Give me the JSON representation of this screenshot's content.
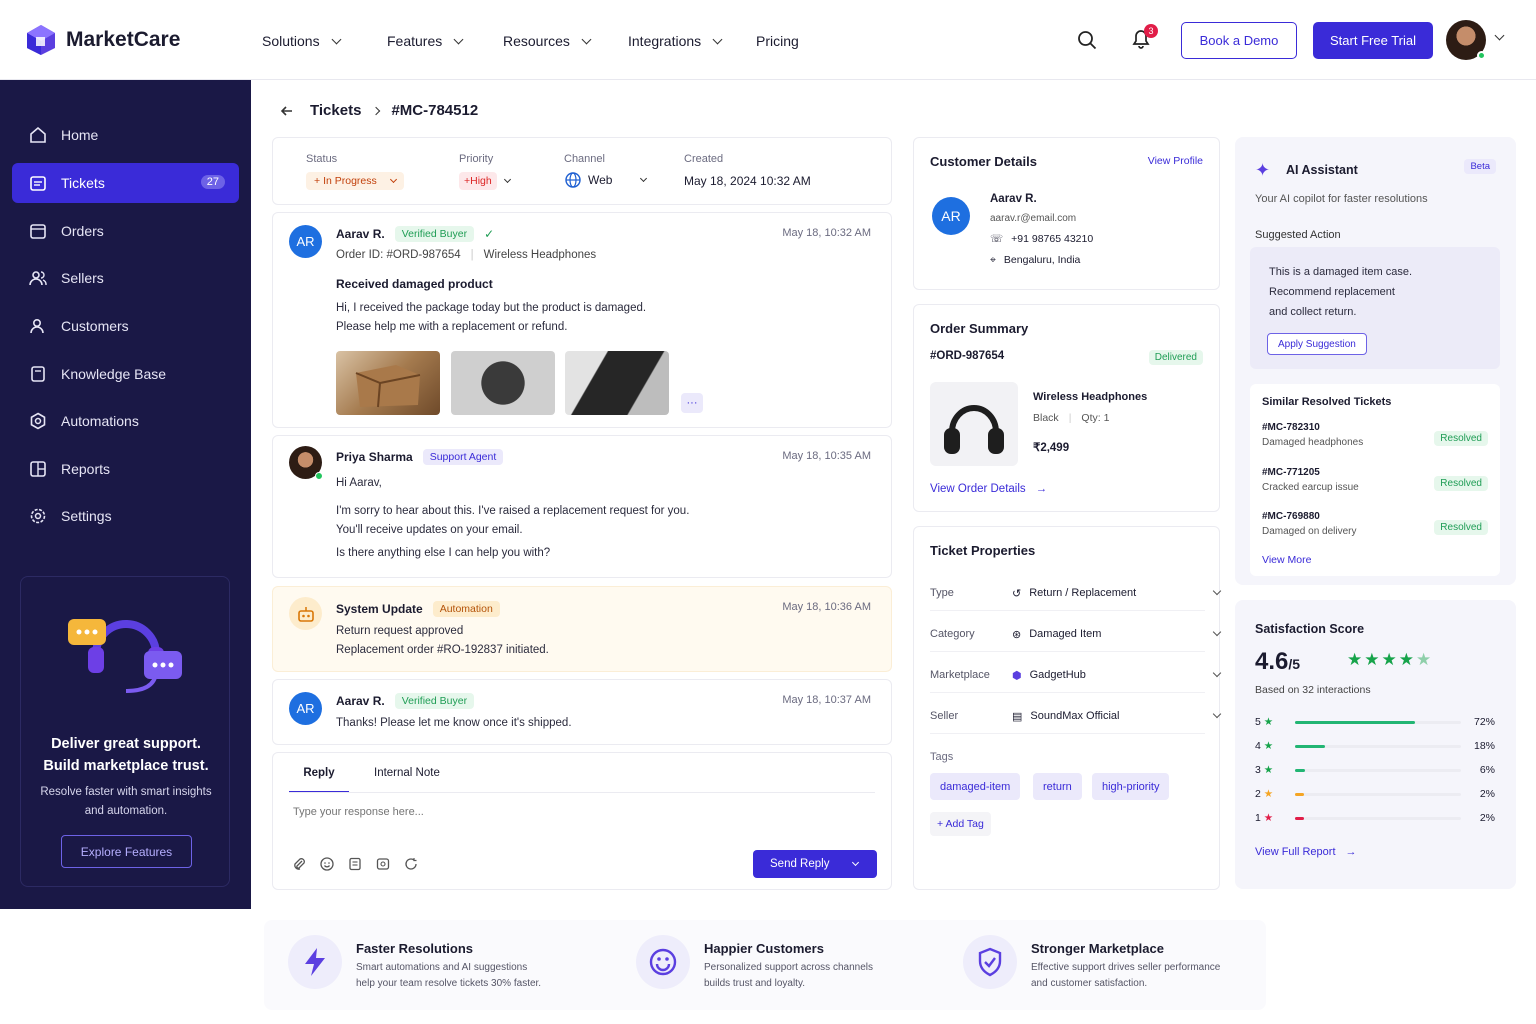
{
  "brand": {
    "name": "MarketCare",
    "color": "#3a2bd8"
  },
  "nav": {
    "items": [
      {
        "label": "Solutions"
      },
      {
        "label": "Features"
      },
      {
        "label": "Resources"
      },
      {
        "label": "Integrations"
      },
      {
        "label": "Pricing"
      }
    ],
    "notif_count": "3",
    "book_demo": "Book a Demo",
    "start_trial": "Start Free Trial"
  },
  "sidebar": {
    "items": [
      {
        "label": "Home",
        "icon": "home-icon"
      },
      {
        "label": "Tickets",
        "icon": "ticket-icon",
        "badge": "27",
        "active": true
      },
      {
        "label": "Orders",
        "icon": "calendar-icon"
      },
      {
        "label": "Sellers",
        "icon": "users-icon"
      },
      {
        "label": "Customers",
        "icon": "user-icon"
      },
      {
        "label": "Knowledge Base",
        "icon": "book-icon"
      },
      {
        "label": "Automations",
        "icon": "gear-icon"
      },
      {
        "label": "Reports",
        "icon": "report-icon"
      },
      {
        "label": "Settings",
        "icon": "settings-icon"
      }
    ],
    "promo": {
      "title1": "Deliver great support.",
      "title2": "Build marketplace trust.",
      "sub1": "Resolve faster with smart insights",
      "sub2": "and automation.",
      "button": "Explore Features"
    }
  },
  "breadcrumb": {
    "parent": "Tickets",
    "current": "#MC-784512"
  },
  "meta": {
    "status_label": "Status",
    "status": "In Progress",
    "priority_label": "Priority",
    "priority": "High",
    "channel_label": "Channel",
    "channel": "Web",
    "created_label": "Created",
    "created": "May 18, 2024 10:32 AM"
  },
  "thread": [
    {
      "initials": "AR",
      "name": "Aarav R.",
      "badge": "Verified Buyer",
      "time": "May 18, 10:32 AM",
      "order": "Order ID: #ORD-987654",
      "product": "Wireless Headphones",
      "subject": "Received damaged product",
      "lines": [
        "Hi, I received the package today but the product is damaged.",
        "Please help me with a replacement or refund."
      ],
      "more": "···"
    },
    {
      "name": "Priya Sharma",
      "badge": "Support Agent",
      "time": "May 18, 10:35 AM",
      "lines": [
        "Hi Aarav,",
        "I'm sorry to hear about this. I've raised a replacement request for you.",
        "You'll receive updates on your email.",
        "Is there anything else I can help you with?"
      ]
    },
    {
      "name": "System Update",
      "badge": "Automation",
      "time": "May 18, 10:36 AM",
      "lines": [
        "Return request approved",
        "Replacement order #RO-192837 initiated."
      ]
    },
    {
      "initials": "AR",
      "name": "Aarav R.",
      "badge": "Verified Buyer",
      "time": "May 18, 10:37 AM",
      "lines": [
        "Thanks! Please let me know once it's shipped."
      ]
    }
  ],
  "reply": {
    "tab_reply": "Reply",
    "tab_note": "Internal Note",
    "placeholder": "Type your response here...",
    "send": "Send Reply"
  },
  "customer": {
    "title": "Customer Details",
    "view_profile": "View Profile",
    "initials": "AR",
    "name": "Aarav R.",
    "email": "aarav.r@email.com",
    "phone": "+91 98765 43210",
    "location": "Bengaluru, India"
  },
  "order": {
    "title": "Order Summary",
    "id": "#ORD-987654",
    "status": "Delivered",
    "product": "Wireless Headphones",
    "color": "Black",
    "qty": "Qty: 1",
    "price": "₹2,499",
    "link": "View Order Details"
  },
  "properties": {
    "title": "Ticket Properties",
    "rows": [
      {
        "key": "Type",
        "value": "Return / Replacement"
      },
      {
        "key": "Category",
        "value": "Damaged Item"
      },
      {
        "key": "Marketplace",
        "value": "GadgetHub"
      },
      {
        "key": "Seller",
        "value": "SoundMax Official"
      }
    ],
    "tags_label": "Tags",
    "tags": [
      "damaged-item",
      "return",
      "high-priority"
    ],
    "add_tag": "+ Add Tag"
  },
  "ai": {
    "title": "AI Assistant",
    "beta": "Beta",
    "subtitle": "Your AI copilot for faster resolutions",
    "suggested_label": "Suggested Action",
    "suggestion": [
      "This is a damaged item case.",
      "Recommend replacement",
      "and collect return."
    ],
    "apply": "Apply Suggestion",
    "similar_title": "Similar Resolved Tickets",
    "similar": [
      {
        "id": "#MC-782310",
        "desc": "Damaged headphones",
        "status": "Resolved"
      },
      {
        "id": "#MC-771205",
        "desc": "Cracked earcup issue",
        "status": "Resolved"
      },
      {
        "id": "#MC-769880",
        "desc": "Damaged on delivery",
        "status": "Resolved"
      }
    ],
    "view_more": "View More"
  },
  "satisfaction": {
    "title": "Satisfaction Score",
    "score": "4.6",
    "out_of": "/5",
    "rating": 4.6,
    "based": "Based on 32 interactions",
    "bars": [
      {
        "label": "5",
        "pct": "72%",
        "value": 72,
        "color": "#22b573"
      },
      {
        "label": "4",
        "pct": "18%",
        "value": 18,
        "color": "#22b573"
      },
      {
        "label": "3",
        "pct": "6%",
        "value": 6,
        "color": "#22b573"
      },
      {
        "label": "2",
        "pct": "2%",
        "value": 2,
        "color": "#f5a524"
      },
      {
        "label": "1",
        "pct": "2%",
        "value": 2,
        "color": "#e11d48"
      }
    ],
    "link": "View Full Report"
  },
  "features": [
    {
      "title": "Faster Resolutions",
      "l1": "Smart automations and AI suggestions",
      "l2": "help your team resolve tickets 30% faster."
    },
    {
      "title": "Happier Customers",
      "l1": "Personalized support across channels",
      "l2": "builds trust and loyalty."
    },
    {
      "title": "Stronger Marketplace",
      "l1": "Effective support drives seller performance",
      "l2": "and customer satisfaction."
    }
  ]
}
